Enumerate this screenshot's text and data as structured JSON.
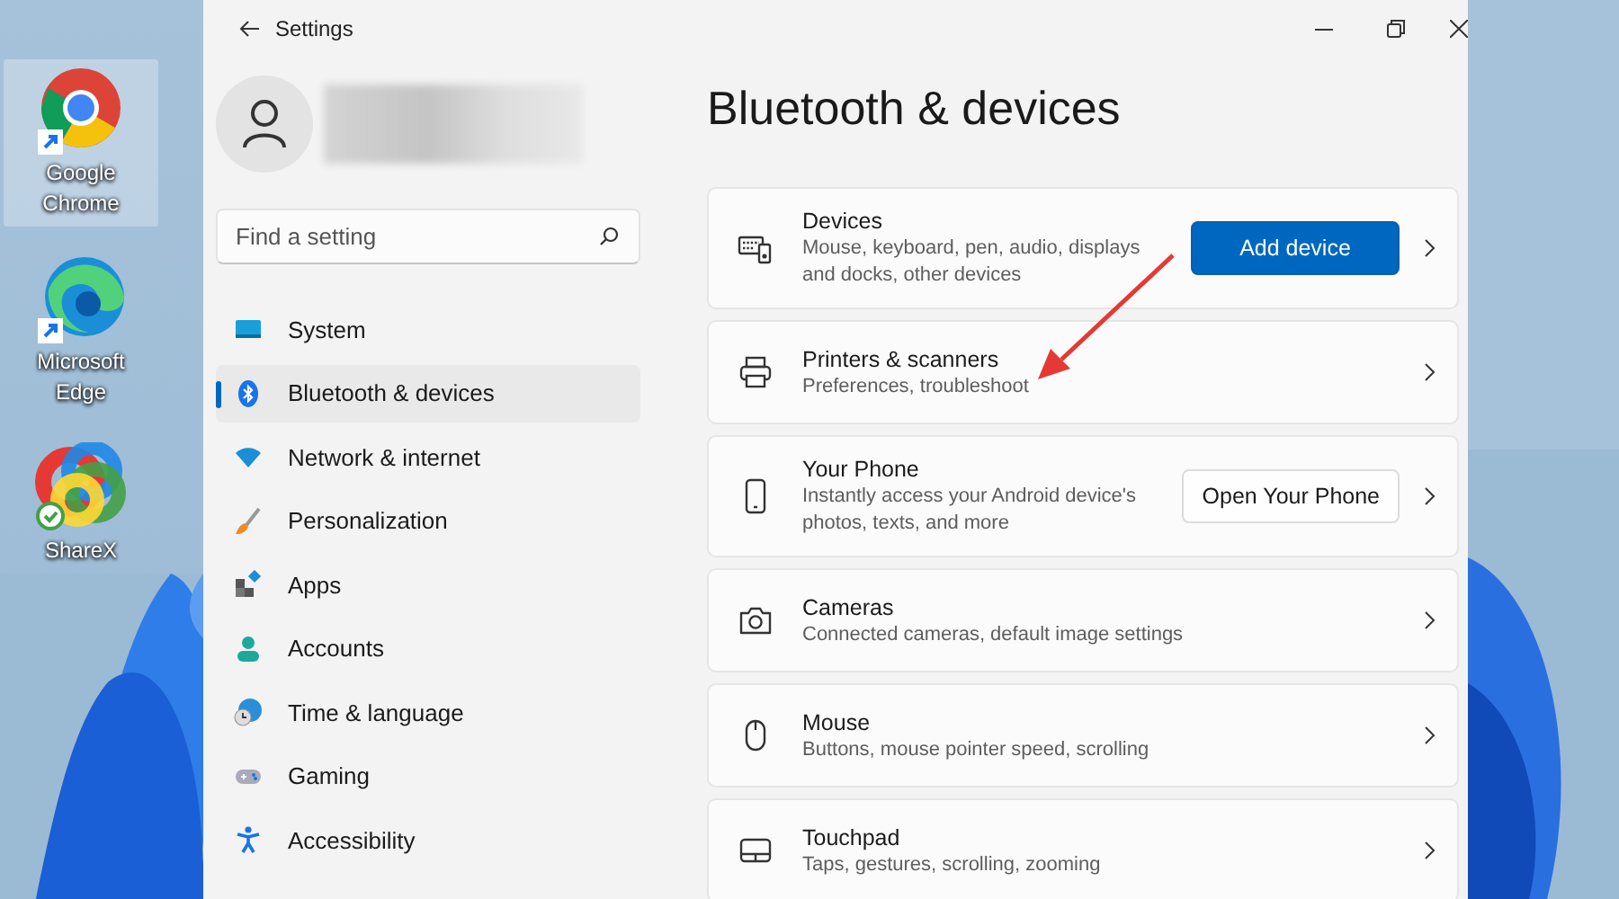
{
  "desktop_icons": [
    {
      "label": "Google Chrome",
      "selected": true
    },
    {
      "label": "Microsoft Edge",
      "selected": false
    },
    {
      "label": "ShareX",
      "selected": false
    }
  ],
  "window": {
    "title": "Settings"
  },
  "search": {
    "placeholder": "Find a setting"
  },
  "nav": [
    {
      "label": "System",
      "selected": false
    },
    {
      "label": "Bluetooth & devices",
      "selected": true
    },
    {
      "label": "Network & internet",
      "selected": false
    },
    {
      "label": "Personalization",
      "selected": false
    },
    {
      "label": "Apps",
      "selected": false
    },
    {
      "label": "Accounts",
      "selected": false
    },
    {
      "label": "Time & language",
      "selected": false
    },
    {
      "label": "Gaming",
      "selected": false
    },
    {
      "label": "Accessibility",
      "selected": false
    }
  ],
  "heading": "Bluetooth & devices",
  "cards": [
    {
      "title": "Devices",
      "description": "Mouse, keyboard, pen, audio, displays and docks, other devices",
      "button": {
        "label": "Add device",
        "kind": "primary"
      }
    },
    {
      "title": "Printers & scanners",
      "description": "Preferences, troubleshoot"
    },
    {
      "title": "Your Phone",
      "description": "Instantly access your Android device's photos, texts, and more",
      "button": {
        "label": "Open Your Phone",
        "kind": "secondary"
      }
    },
    {
      "title": "Cameras",
      "description": "Connected cameras, default image settings"
    },
    {
      "title": "Mouse",
      "description": "Buttons, mouse pointer speed, scrolling"
    },
    {
      "title": "Touchpad",
      "description": "Taps, gestures, scrolling, zooming"
    }
  ]
}
